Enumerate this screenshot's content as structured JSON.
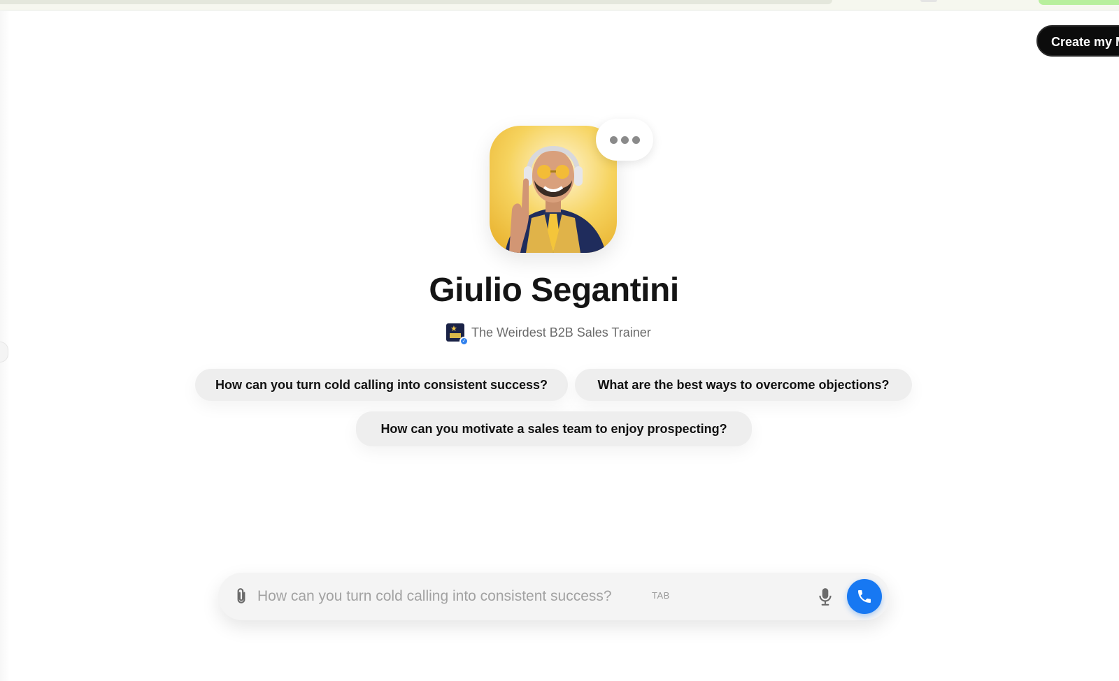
{
  "header": {
    "create_button_label": "Create my M"
  },
  "profile": {
    "name": "Giulio Segantini",
    "tagline": "The Weirdest B2B Sales Trainer",
    "avatar_icon": "person-portrait-avatar",
    "verified_icon": "verified-badge-icon"
  },
  "suggestions": [
    {
      "label": "How can you turn cold calling into consistent success?"
    },
    {
      "label": "What are the best ways to overcome objections?"
    },
    {
      "label": "How can you motivate a sales team to enjoy prospecting?"
    }
  ],
  "composer": {
    "placeholder": "How can you turn cold calling into consistent success?",
    "value": "",
    "tab_hint": "TAB",
    "attach_icon": "paperclip-icon",
    "mic_icon": "microphone-icon",
    "call_icon": "phone-icon"
  },
  "colors": {
    "accent": "#1778f2",
    "create_button_bg": "#0c0c0c",
    "chip_bg": "#eeeeee",
    "avatar_bg": "#f1c446",
    "progress_green": "#b8ef9d"
  }
}
